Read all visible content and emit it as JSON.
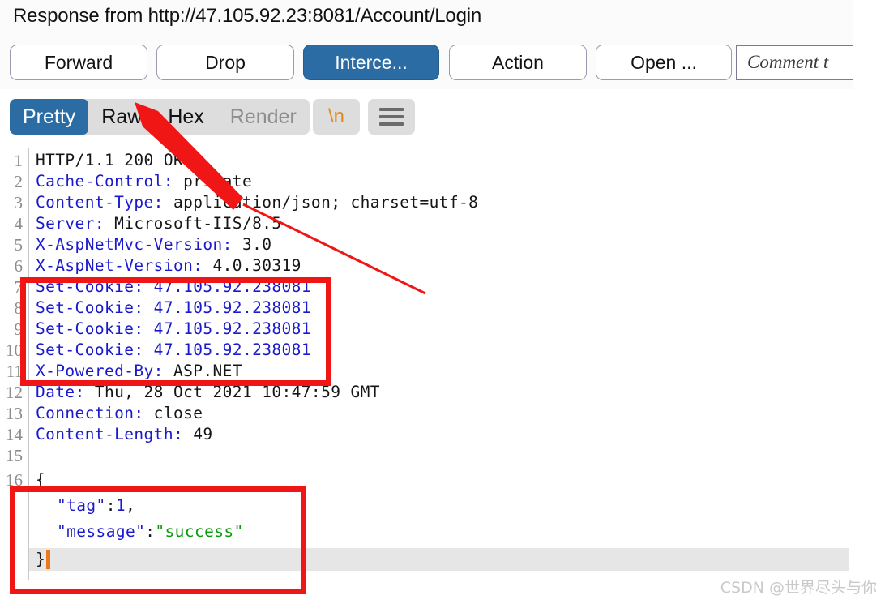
{
  "window": {
    "title": "Response from http://47.105.92.23:8081/Account/Login"
  },
  "toolbar": {
    "forward_label": "Forward",
    "drop_label": "Drop",
    "intercept_label": "Interce...",
    "action_label": "Action",
    "open_label": "Open ...",
    "comment_placeholder": "Comment t",
    "accent_color": "#2a6ca3"
  },
  "tabs": {
    "items": [
      {
        "label": "Pretty",
        "state": "active"
      },
      {
        "label": "Raw",
        "state": "normal"
      },
      {
        "label": "Hex",
        "state": "normal"
      },
      {
        "label": "Render",
        "state": "disabled"
      }
    ],
    "newline_button": "\\n",
    "menu_button": "hamburger-menu-icon"
  },
  "editor": {
    "lines": [
      {
        "n": "1",
        "name": "HTTP/1.1 200 OK",
        "value": "",
        "style": "status"
      },
      {
        "n": "2",
        "name": "Cache-Control:",
        "value": " private",
        "style": "header"
      },
      {
        "n": "3",
        "name": "Content-Type:",
        "value": " application/json; charset=utf-8",
        "style": "header"
      },
      {
        "n": "4",
        "name": "Server:",
        "value": " Microsoft-IIS/8.5",
        "style": "header"
      },
      {
        "n": "5",
        "name": "X-AspNetMvc-Version:",
        "value": " 3.0",
        "style": "header"
      },
      {
        "n": "6",
        "name": "X-AspNet-Version:",
        "value": " 4.0.30319",
        "style": "header"
      },
      {
        "n": "7",
        "name": "Set-Cookie:",
        "value": " 47.105.92.238081",
        "style": "allblue"
      },
      {
        "n": "8",
        "name": "Set-Cookie:",
        "value": " 47.105.92.238081",
        "style": "allblue"
      },
      {
        "n": "9",
        "name": "Set-Cookie:",
        "value": " 47.105.92.238081",
        "style": "allblue"
      },
      {
        "n": "10",
        "name": "Set-Cookie:",
        "value": " 47.105.92.238081",
        "style": "allblue"
      },
      {
        "n": "11",
        "name": "X-Powered-By:",
        "value": " ASP.NET",
        "style": "header"
      },
      {
        "n": "12",
        "name": "Date:",
        "value": " Thu, 28 Oct 2021 10:47:59 GMT",
        "style": "header"
      },
      {
        "n": "13",
        "name": "Connection:",
        "value": " close",
        "style": "header"
      },
      {
        "n": "14",
        "name": "Content-Length:",
        "value": " 49",
        "style": "header"
      },
      {
        "n": "15",
        "name": "",
        "value": "",
        "style": "blank"
      },
      {
        "n": "16",
        "name": "{",
        "value": "",
        "style": "punct"
      }
    ],
    "body": {
      "open_brace": "{",
      "tag_key": "\"tag\"",
      "tag_sep": ":",
      "tag_value": "1",
      "tag_comma": ",",
      "message_key": "\"message\"",
      "message_sep": ":",
      "message_value": "\"success\"",
      "close_brace": "}"
    }
  },
  "annotations": {
    "box_cookies_label": "set-cookie-highlight",
    "box_body_label": "json-body-highlight",
    "arrow_label": "pointer-arrow",
    "arrow_color": "#f01616"
  },
  "watermark": {
    "text": "CSDN @世界尽头与你"
  }
}
